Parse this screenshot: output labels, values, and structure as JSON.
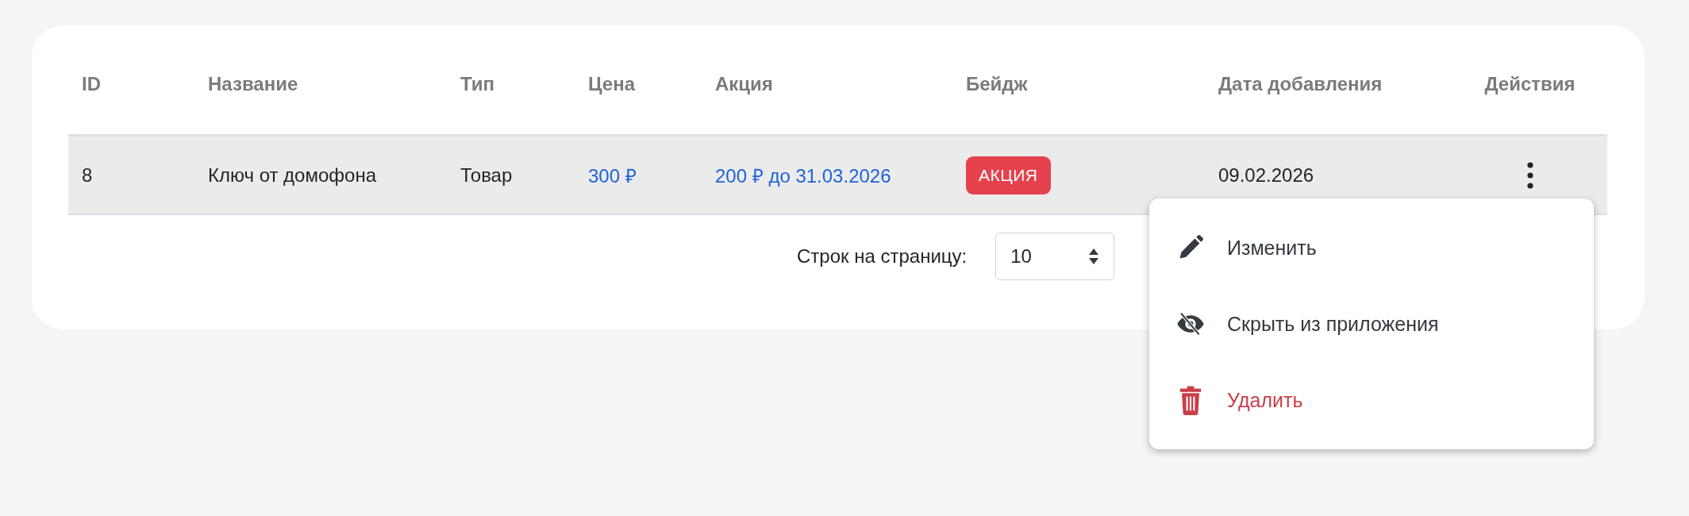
{
  "table": {
    "columns": [
      "ID",
      "Название",
      "Тип",
      "Цена",
      "Акция",
      "Бейдж",
      "Дата добавления",
      "Действия"
    ],
    "rows": [
      {
        "id": "8",
        "name": "Ключ от домофона",
        "type": "Товар",
        "price": "300 ₽",
        "promo": "200 ₽ до 31.03.2026",
        "badge": "АКЦИЯ",
        "date_added": "09.02.2026",
        "highlighted": true
      }
    ]
  },
  "pagination": {
    "label": "Строк на страницу:",
    "rows_per_page": "10"
  },
  "actions_menu": {
    "items": [
      {
        "label": "Изменить",
        "kind": "edit"
      },
      {
        "label": "Скрыть из приложения",
        "kind": "hide"
      },
      {
        "label": "Удалить",
        "kind": "delete"
      }
    ]
  }
}
